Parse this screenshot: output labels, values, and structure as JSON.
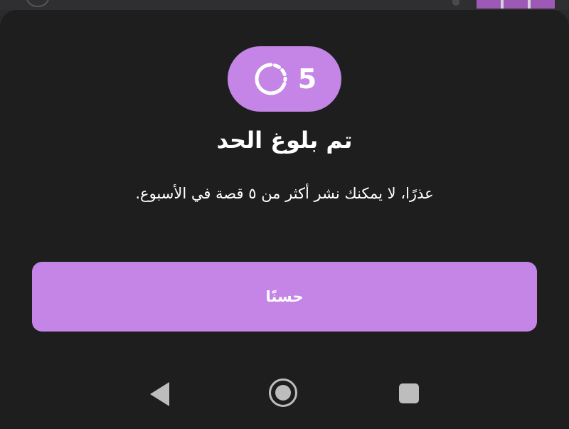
{
  "dialog": {
    "count": "5",
    "icon": "story-progress-icon",
    "title": "تم بلوغ الحد",
    "message": "عذرًا، لا يمكنك نشر أكثر من ٥ قصة في الأسبوع.",
    "ok_label": "حسنًا"
  },
  "nav": {
    "back_icon": "back-icon",
    "home_icon": "home-icon",
    "recents_icon": "recents-icon"
  },
  "colors": {
    "accent": "#c485e6",
    "sheet_background": "#1e1e1f",
    "text": "#ffffff",
    "nav_icons": "#bdbdbd"
  }
}
